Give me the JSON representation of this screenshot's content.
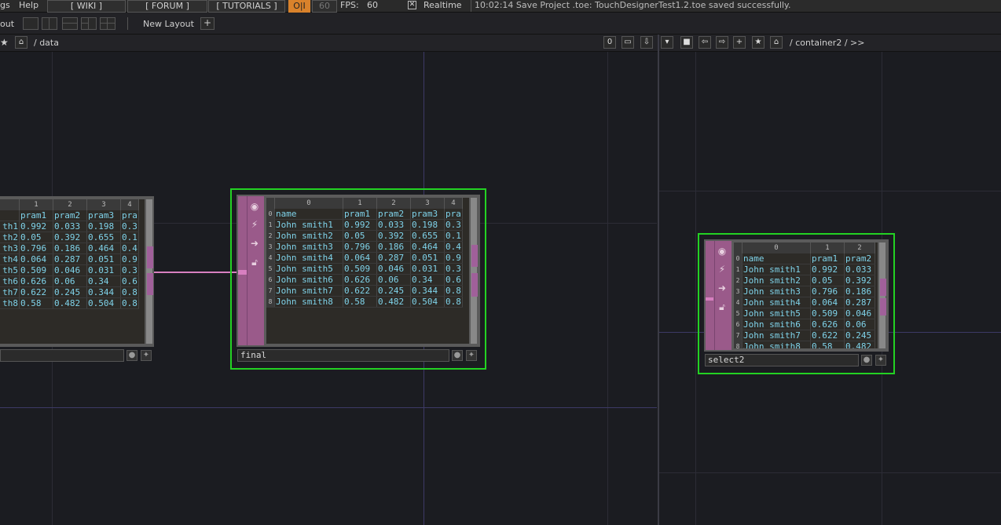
{
  "menubar": {
    "cut_label": "gs",
    "help_label": "Help",
    "wiki_label": "[ WIKI ]",
    "forum_label": "[ FORUM ]",
    "tutorials_label": "[ TUTORIALS ]",
    "oi_label": "O|I",
    "fps_limit": "60",
    "fps_label": "FPS:",
    "fps_value": "60",
    "realtime_label": "Realtime",
    "status_text": "10:02:14 Save Project .toe: TouchDesignerTest1.2.toe saved successfully."
  },
  "layoutbar": {
    "cut_label": "out",
    "new_layout_label": "New Layout",
    "add_label": "+"
  },
  "left_pane": {
    "path": "/ data",
    "zero_label": "0"
  },
  "right_pane": {
    "path": "/ container2 / >>"
  },
  "nodes": {
    "final": {
      "name": "final",
      "col_headers": [
        "",
        "0",
        "1",
        "2",
        "3",
        "4"
      ],
      "rows": [
        [
          "0",
          "name",
          "pram1",
          "pram2",
          "pram3",
          "pra"
        ],
        [
          "1",
          "John smith1",
          "0.992",
          "0.033",
          "0.198",
          "0.3"
        ],
        [
          "2",
          "John smith2",
          "0.05",
          "0.392",
          "0.655",
          "0.1"
        ],
        [
          "3",
          "John smith3",
          "0.796",
          "0.186",
          "0.464",
          "0.4"
        ],
        [
          "4",
          "John smith4",
          "0.064",
          "0.287",
          "0.051",
          "0.9"
        ],
        [
          "5",
          "John smith5",
          "0.509",
          "0.046",
          "0.031",
          "0.3"
        ],
        [
          "6",
          "John smith6",
          "0.626",
          "0.06",
          "0.34",
          "0.6"
        ],
        [
          "7",
          "John smith7",
          "0.622",
          "0.245",
          "0.344",
          "0.8"
        ],
        [
          "8",
          "John smith8",
          "0.58",
          "0.482",
          "0.504",
          "0.8"
        ]
      ]
    },
    "select2": {
      "name": "select2",
      "col_headers": [
        "",
        "0",
        "1",
        "2"
      ],
      "rows": [
        [
          "0",
          "name",
          "pram1",
          "pram2"
        ],
        [
          "1",
          "John smith1",
          "0.992",
          "0.033"
        ],
        [
          "2",
          "John smith2",
          "0.05",
          "0.392"
        ],
        [
          "3",
          "John smith3",
          "0.796",
          "0.186"
        ],
        [
          "4",
          "John smith4",
          "0.064",
          "0.287"
        ],
        [
          "5",
          "John smith5",
          "0.509",
          "0.046"
        ],
        [
          "6",
          "John smith6",
          "0.626",
          "0.06"
        ],
        [
          "7",
          "John smith7",
          "0.622",
          "0.245"
        ],
        [
          "8",
          "John smith8",
          "0.58",
          "0.482"
        ]
      ]
    },
    "left_partial": {
      "col_headers": [
        "1",
        "2",
        "3",
        "4"
      ],
      "rows": [
        [
          "",
          "pram1",
          "pram2",
          "pram3",
          "pra"
        ],
        [
          "th1",
          "0.992",
          "0.033",
          "0.198",
          "0.3"
        ],
        [
          "th2",
          "0.05",
          "0.392",
          "0.655",
          "0.1"
        ],
        [
          "th3",
          "0.796",
          "0.186",
          "0.464",
          "0.4"
        ],
        [
          "th4",
          "0.064",
          "0.287",
          "0.051",
          "0.9"
        ],
        [
          "th5",
          "0.509",
          "0.046",
          "0.031",
          "0.3"
        ],
        [
          "th6",
          "0.626",
          "0.06",
          "0.34",
          "0.6"
        ],
        [
          "th7",
          "0.622",
          "0.245",
          "0.344",
          "0.8"
        ],
        [
          "th8",
          "0.58",
          "0.482",
          "0.504",
          "0.8"
        ]
      ]
    }
  },
  "colors": {
    "selection": "#23d223",
    "node_sidebar": "#9a5a8a",
    "cell_text": "#7fd3ea",
    "wire": "#d77fc0",
    "oi_active": "#d9822b"
  }
}
